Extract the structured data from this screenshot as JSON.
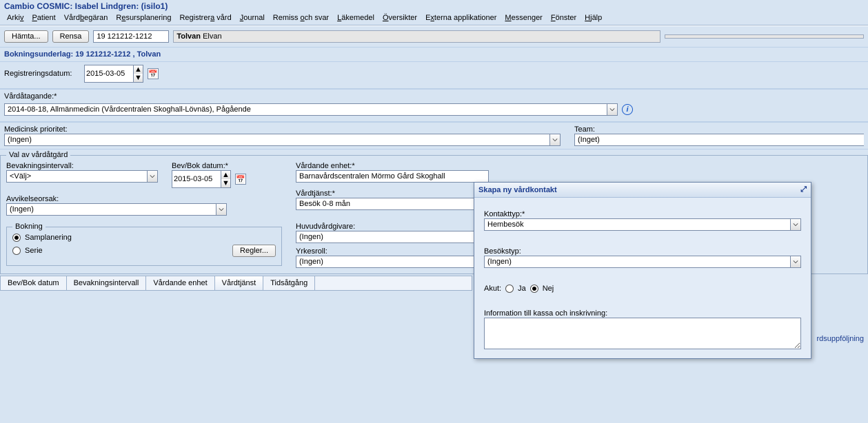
{
  "window_title": "Cambio COSMIC: Isabel Lindgren: (isilo1)",
  "menu": [
    "Arkiv",
    "Patient",
    "Vårdbegäran",
    "Resursplanering",
    "Registrera vård",
    "Journal",
    "Remiss och svar",
    "Läkemedel",
    "Översikter",
    "Externa applikationer",
    "Messenger",
    "Fönster",
    "Hjälp"
  ],
  "toolbar": {
    "hamta": "Hämta...",
    "rensa": "Rensa",
    "pnr": "19 121212-1212",
    "name_bold": "Tolvan",
    "name_rest": " Elvan"
  },
  "section_title": "Bokningsunderlag: 19 121212-1212 , Tolvan",
  "reg": {
    "label": "Registreringsdatum:",
    "value": "2015-03-05"
  },
  "vard": {
    "label": "Vårdåtagande:*",
    "value": "2014-08-18, Allmänmedicin (Vårdcentralen Skoghall-Lövnäs), Pågående"
  },
  "medprio": {
    "label": "Medicinsk prioritet:",
    "value": "(Ingen)"
  },
  "team": {
    "label": "Team:",
    "value": "(Inget)"
  },
  "fieldset1_legend": "Val av vårdåtgärd",
  "bevint": {
    "label": "Bevakningsintervall:",
    "value": "<Välj>"
  },
  "bevbok": {
    "label": "Bev/Bok datum:*",
    "value": "2015-03-05"
  },
  "avvik": {
    "label": "Avvikelseorsak:",
    "value": "(Ingen)"
  },
  "booking_legend": "Bokning",
  "booking_samplanering": "Samplanering",
  "booking_serie": "Serie",
  "regler_btn": "Regler...",
  "vardande": {
    "label": "Vårdande enhet:*",
    "value": "Barnavårdscentralen Mörmo Gård Skoghall"
  },
  "vardtjanst": {
    "label": "Vårdtjänst:*",
    "value": "Besök 0-8 mån"
  },
  "huvudvg": {
    "label": "Huvudvårdgivare:",
    "value": "(Ingen)"
  },
  "yrkesroll": {
    "label": "Yrkesroll:",
    "value": "(Ingen)"
  },
  "tabs": [
    "Bev/Bok datum",
    "Bevakningsintervall",
    "Vårdande enhet",
    "Vårdtjänst",
    "Tidsåtgång"
  ],
  "popup": {
    "title": "Skapa ny vårdkontakt",
    "kontakttyp": {
      "label": "Kontakttyp:*",
      "value": "Hembesök"
    },
    "besokstyp": {
      "label": "Besökstyp:",
      "value": "(Ingen)"
    },
    "akut_label": "Akut:",
    "ja": "Ja",
    "nej": "Nej",
    "akut_sel": "Nej",
    "info_label": "Information till kassa och inskrivning:"
  },
  "right_cut": "rdsuppföljning"
}
